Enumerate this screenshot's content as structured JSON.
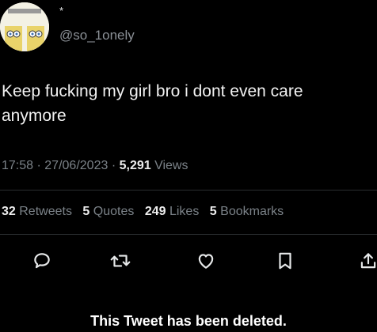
{
  "tweet": {
    "display_name": "*",
    "handle": "@so_1onely",
    "text": "Keep fucking my girl bro i dont even care anymore",
    "time": "17:58",
    "date": "27/06/2023",
    "views_count": "5,291",
    "views_label": "Views"
  },
  "stats": {
    "retweets_count": "32",
    "retweets_label": "Retweets",
    "quotes_count": "5",
    "quotes_label": "Quotes",
    "likes_count": "249",
    "likes_label": "Likes",
    "bookmarks_count": "5",
    "bookmarks_label": "Bookmarks"
  },
  "actions": {
    "reply_icon": "reply-icon",
    "retweet_icon": "retweet-icon",
    "like_icon": "heart-icon",
    "bookmark_icon": "bookmark-icon",
    "share_icon": "share-icon"
  },
  "footer": {
    "deleted_notice": "This Tweet has been deleted."
  },
  "colors": {
    "background": "#000000",
    "text": "#e7e9ea",
    "secondary_text": "#7b8288",
    "divider": "#2a2d30"
  }
}
